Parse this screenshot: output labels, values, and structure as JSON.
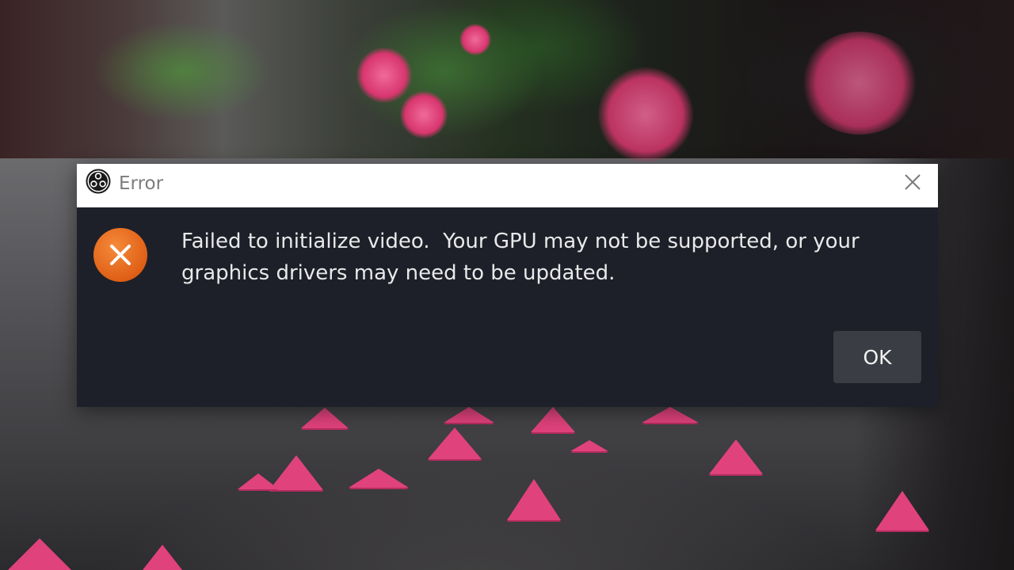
{
  "dialog": {
    "title": "Error",
    "message_line1": "Failed to initialize video.  Your GPU may not be supported, or your",
    "message_line2": "graphics drivers may need to be updated.",
    "ok_label": "OK"
  },
  "icons": {
    "app_logo": "obs-logo-icon",
    "close": "close-icon",
    "error": "error-icon"
  },
  "colors": {
    "dialog_background": "#1d2028",
    "titlebar_background": "#ffffff",
    "error_icon": "#e8681c",
    "ok_button": "#3a3d44"
  }
}
